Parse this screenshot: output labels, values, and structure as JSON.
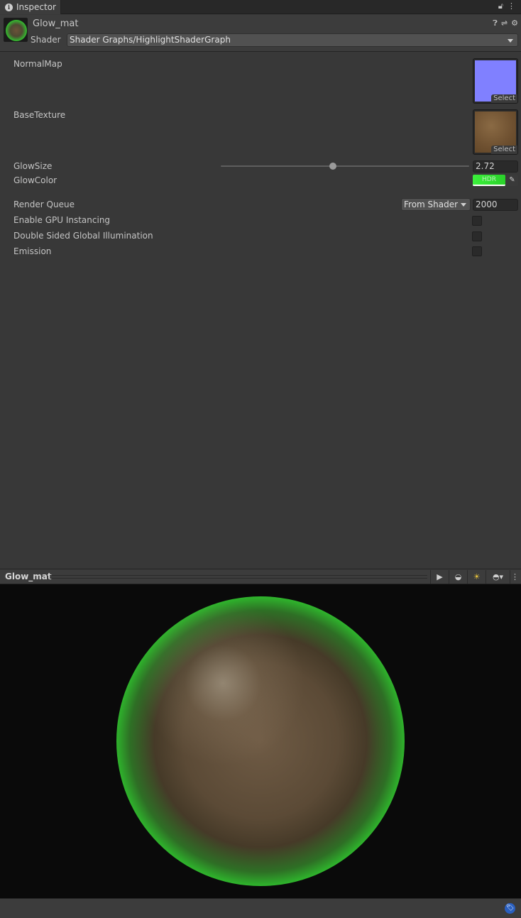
{
  "tab": {
    "title": "Inspector",
    "lock_icon": "lock-icon",
    "menu_icon": "kebab-menu-icon"
  },
  "header": {
    "material_name": "Glow_mat",
    "shader_label": "Shader",
    "shader_value": "Shader Graphs/HighlightShaderGraph",
    "icons": [
      "help-icon",
      "preset-icon",
      "gear-icon"
    ]
  },
  "properties": {
    "normal_map": {
      "label": "NormalMap",
      "select": "Select",
      "swatch": "#8080ff"
    },
    "base_texture": {
      "label": "BaseTexture",
      "select": "Select",
      "swatch": "#7a5a36"
    },
    "glow_size": {
      "label": "GlowSize",
      "value": "2.72",
      "slider_fraction": 0.45
    },
    "glow_color": {
      "label": "GlowColor",
      "badge": "HDR",
      "color": "#3bf03b"
    }
  },
  "advanced": {
    "render_queue": {
      "label": "Render Queue",
      "mode": "From Shader",
      "value": "2000"
    },
    "gpu_instancing": {
      "label": "Enable GPU Instancing",
      "checked": false
    },
    "double_sided_gi": {
      "label": "Double Sided Global Illumination",
      "checked": false
    },
    "emission": {
      "label": "Emission",
      "checked": false
    }
  },
  "preview": {
    "title": "Glow_mat",
    "buttons": [
      "play-icon",
      "sphere-mesh-icon",
      "lights-icon",
      "background-sphere-icon"
    ]
  },
  "colors": {
    "glow": "#3cff3c",
    "panel": "#383838",
    "viewport": "#0a0a0a"
  }
}
